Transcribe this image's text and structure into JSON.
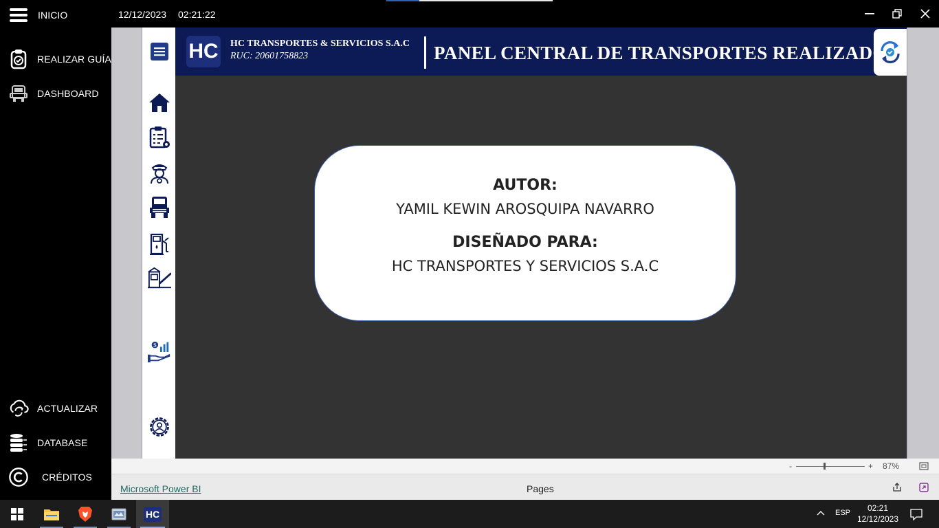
{
  "sidebar": {
    "items": [
      {
        "label": "INICIO",
        "icon": "hamburger-icon"
      },
      {
        "label": "REALIZAR GUÍA",
        "icon": "clipboard-check-icon"
      },
      {
        "label": "DASHBOARD",
        "icon": "truck-front-icon"
      },
      {
        "label": "ACTUALIZAR",
        "icon": "cloud-sync-icon"
      },
      {
        "label": "DATABASE",
        "icon": "database-icon"
      },
      {
        "label": "CRÉDITOS",
        "icon": "copyright-icon"
      }
    ]
  },
  "titlebar": {
    "date": "12/12/2023",
    "time": "02:21:22"
  },
  "report": {
    "logo_text": "HC",
    "company": "HC TRANSPORTES & SERVICIOS S.A.C",
    "ruc": "RUC: 20601758823",
    "title": "PANEL CENTRAL DE TRANSPORTES REALIZADOS",
    "card": {
      "author_heading": "AUTOR:",
      "author_name": "YAMIL KEWIN AROSQUIPA NAVARRO",
      "designed_heading": "DISEÑADO PARA:",
      "designed_for": "HC TRANSPORTES Y SERVICIOS S.A.C"
    }
  },
  "zoom": {
    "minus": "-",
    "plus": "+",
    "level": "87%"
  },
  "footer": {
    "powerbi_link": "Microsoft Power BI",
    "pages_label": "Pages"
  },
  "taskbar": {
    "app_label": "HC",
    "language": "ESP",
    "clock_time": "02:21",
    "clock_date": "12/12/2023"
  },
  "colors": {
    "header_bg": "#0c1a55",
    "canvas_bg": "#333333",
    "accent": "#1f3c88"
  }
}
